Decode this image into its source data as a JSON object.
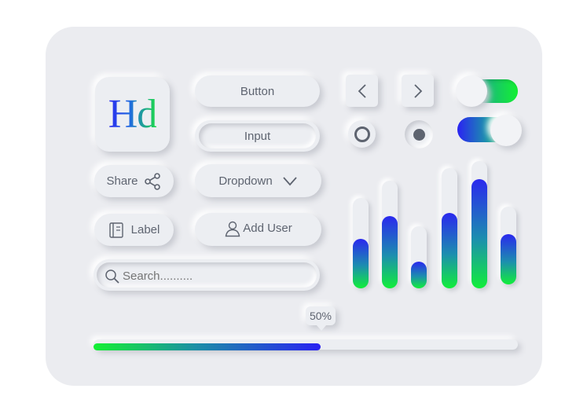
{
  "logo": {
    "text": "Hd"
  },
  "buttons": {
    "button_label": "Button",
    "input_label": "Input",
    "dropdown_label": "Dropdown",
    "share_label": "Share",
    "label_label": "Label",
    "add_user_label": "Add User"
  },
  "search": {
    "placeholder": "Search.........."
  },
  "nav": {
    "prev_icon": "chevron-left-icon",
    "next_icon": "chevron-right-icon"
  },
  "radios": [
    {
      "selected": false
    },
    {
      "selected": true
    }
  ],
  "toggles": [
    {
      "on": true
    },
    {
      "on": false
    }
  ],
  "level_bars": [
    {
      "level": 0.55
    },
    {
      "level": 0.67
    },
    {
      "level": 0.43
    },
    {
      "level": 0.63
    },
    {
      "level": 0.86
    },
    {
      "level": 0.65
    }
  ],
  "progress": {
    "value": 0.5,
    "label": "50%"
  },
  "colors": {
    "gradient_blue": "#2a22f2",
    "gradient_green": "#14f033",
    "background": "#ebecf0"
  }
}
